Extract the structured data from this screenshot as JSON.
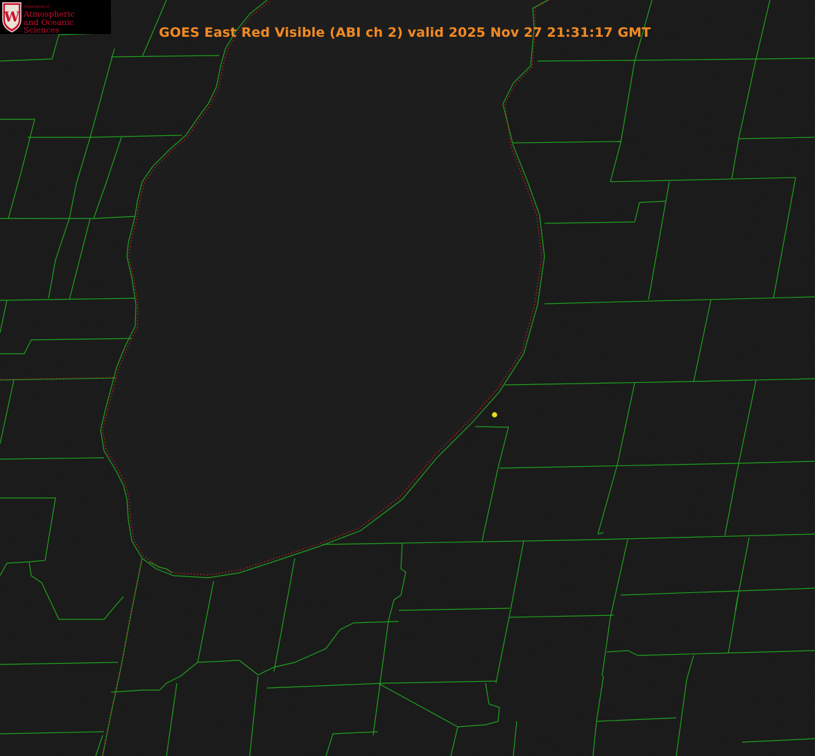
{
  "title": "GOES East Red Visible (ABI ch 2) valid 2025 Nov 27 21:31:17 GMT",
  "logo": {
    "department": "Department of",
    "name_line1": "Atmospheric",
    "name_line2": "and Oceanic Sciences",
    "crest_letter": "W"
  },
  "colors": {
    "background": "#161616",
    "lake": "#1d1d1d",
    "county_lines": "#1fa31f",
    "shoreline_dots": "#d42020",
    "title": "#f08a24",
    "logo_red": "#c8102e",
    "station_marker": "#e6e01e"
  },
  "map_layers": [
    "satellite-visible-imagery",
    "county-boundaries",
    "state-boundary",
    "lake-shoreline",
    "station-marker"
  ]
}
